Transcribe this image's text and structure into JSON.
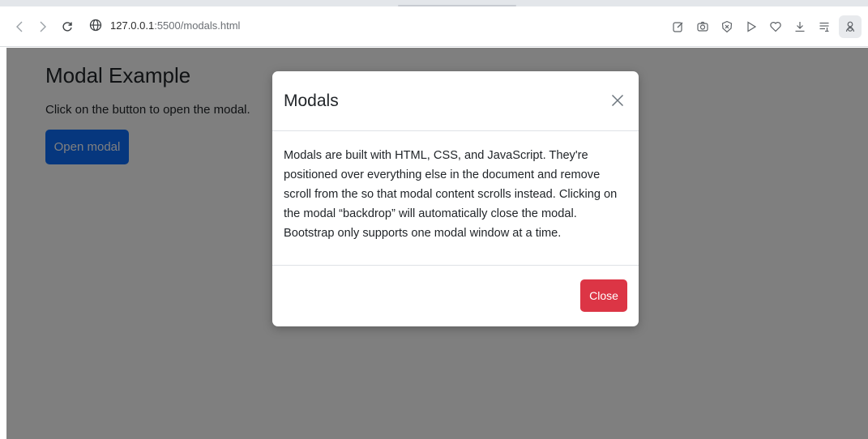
{
  "browser": {
    "url_host": "127.0.0.1",
    "url_rest": ":5500/modals.html",
    "icons": [
      "back-icon",
      "forward-icon",
      "reload-icon",
      "site-info-icon",
      "edit-icon",
      "camera-icon",
      "shield-icon",
      "play-icon",
      "heart-icon",
      "download-icon",
      "reading-list-icon",
      "profile-icon"
    ]
  },
  "page": {
    "title": "Modal Example",
    "description": "Click on the button to open the modal.",
    "open_button_label": "Open modal"
  },
  "modal": {
    "title": "Modals",
    "body_lines": [
      "Modals are built with HTML, CSS, and JavaScript. They're",
      "positioned over everything else in the document and remove",
      "scroll from the so that modal content scrolls instead. Clicking on",
      "the modal “backdrop” will automatically close the modal.",
      "Bootstrap only supports one modal window at a time."
    ],
    "close_button_label": "Close"
  },
  "colors": {
    "primary": "#0d6efd",
    "danger": "#dc3545",
    "backdrop": "rgba(0,0,0,0.5)"
  }
}
